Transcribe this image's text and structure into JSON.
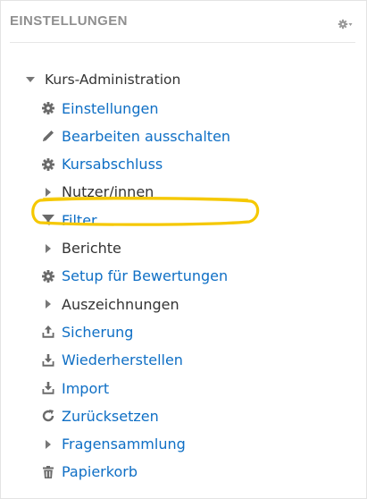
{
  "block": {
    "title": "EINSTELLUNGEN",
    "menu_icon": "gear-icon"
  },
  "tree": {
    "root_label": "Kurs-Administration",
    "items": [
      {
        "label": "Einstellungen",
        "icon": "gear-icon",
        "link": true
      },
      {
        "label": "Bearbeiten ausschalten",
        "icon": "pencil-icon",
        "link": true
      },
      {
        "label": "Kursabschluss",
        "icon": "gear-icon",
        "link": true
      },
      {
        "label": "Nutzer/innen",
        "icon": "caret-right-icon",
        "link": false
      },
      {
        "label": "Filter",
        "icon": "filter-icon",
        "link": true
      },
      {
        "label": "Berichte",
        "icon": "caret-right-icon",
        "link": false
      },
      {
        "label": "Setup für Bewertungen",
        "icon": "gear-icon",
        "link": true,
        "highlighted": true
      },
      {
        "label": "Auszeichnungen",
        "icon": "caret-right-icon",
        "link": false
      },
      {
        "label": "Sicherung",
        "icon": "upload-icon",
        "link": true
      },
      {
        "label": "Wiederherstellen",
        "icon": "download-icon",
        "link": true
      },
      {
        "label": "Import",
        "icon": "download-icon",
        "link": true
      },
      {
        "label": "Zurücksetzen",
        "icon": "refresh-icon",
        "link": true
      },
      {
        "label": "Fragensammlung",
        "icon": "caret-right-icon",
        "link": true
      },
      {
        "label": "Papierkorb",
        "icon": "trash-icon",
        "link": true
      }
    ]
  },
  "colors": {
    "link": "#0f6fc5",
    "text": "#333333",
    "header": "#8f8f8f",
    "highlight": "#f5c800"
  }
}
